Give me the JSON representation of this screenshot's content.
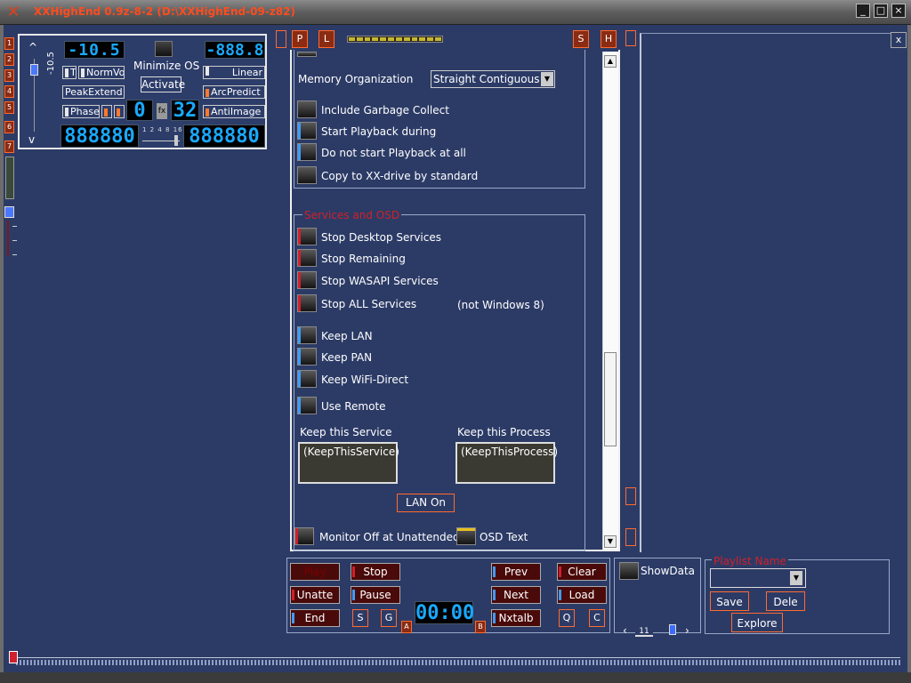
{
  "window": {
    "title": "XXHighEnd 0.9z-8-2 (D:\\XXHighEnd-09-z82)",
    "min": "_",
    "max": "□",
    "close": "×"
  },
  "strip": {
    "buttons": [
      "1",
      "2",
      "3",
      "4",
      "5",
      "6",
      "7"
    ]
  },
  "control": {
    "vol_label": "-10.5",
    "vol_up": "^",
    "vol_down": "v",
    "lcd_vol": "-10.5",
    "lcd_right": "-888.8",
    "minimize_os": "Minimize OS",
    "activate": "Activate",
    "norm_vol": "NormVo",
    "t_label": "T",
    "peak_extend": "PeakExtend",
    "phase": "Phase",
    "linear": "Linear",
    "arc_predict": "ArcPredict",
    "anti_image": "AntiImage",
    "lcd_a": "0",
    "fx": "fx",
    "lcd_b": "32",
    "lcd_bl": "888880",
    "lcd_br": "888880",
    "scale": "1 2 4 8 16"
  },
  "top_pills": {
    "p": "P",
    "l": "L",
    "s": "S",
    "h": "H"
  },
  "settings": {
    "memory_org_label": "Memory Organization",
    "memory_org_value": "Straight Contiguous",
    "include_gc": "Include Garbage Collect",
    "start_playback_during": "Start Playback during",
    "do_not_start": "Do not start Playback at all",
    "copy_xx_drive": "Copy to XX-drive by standard",
    "services_group": "Services and OSD",
    "stop_desktop": "Stop Desktop Services",
    "stop_remaining": "Stop Remaining",
    "stop_wasapi": "Stop WASAPI Services",
    "stop_all": "Stop ALL Services",
    "not_win8": "(not Windows 8)",
    "keep_lan": "Keep LAN",
    "keep_pan": "Keep PAN",
    "keep_wifi": "Keep WiFi-Direct",
    "use_remote": "Use Remote",
    "keep_service_label": "Keep this Service",
    "keep_service_value": "(KeepThisService)",
    "keep_process_label": "Keep this Process",
    "keep_process_value": "(KeepThisProcess)",
    "lan_on": "LAN On",
    "monitor_off": "Monitor Off at Unattended",
    "osd_text": "OSD Text"
  },
  "right_panel": {
    "close": "x"
  },
  "transport": {
    "play": "Play",
    "stop": "Stop",
    "unatte": "Unatte",
    "pause": "Pause",
    "end": "End",
    "s": "S",
    "g": "G",
    "prev": "Prev",
    "next": "Next",
    "nxtalb": "Nxtalb",
    "clear": "Clear",
    "load": "Load",
    "q": "Q",
    "c": "C",
    "time": "00:00",
    "a": "A",
    "b": "B"
  },
  "showdata": {
    "label": "ShowData",
    "page": "11"
  },
  "playlist": {
    "title": "Playlist Name",
    "value": "",
    "save": "Save",
    "delete": "Dele",
    "explore": "Explore"
  }
}
